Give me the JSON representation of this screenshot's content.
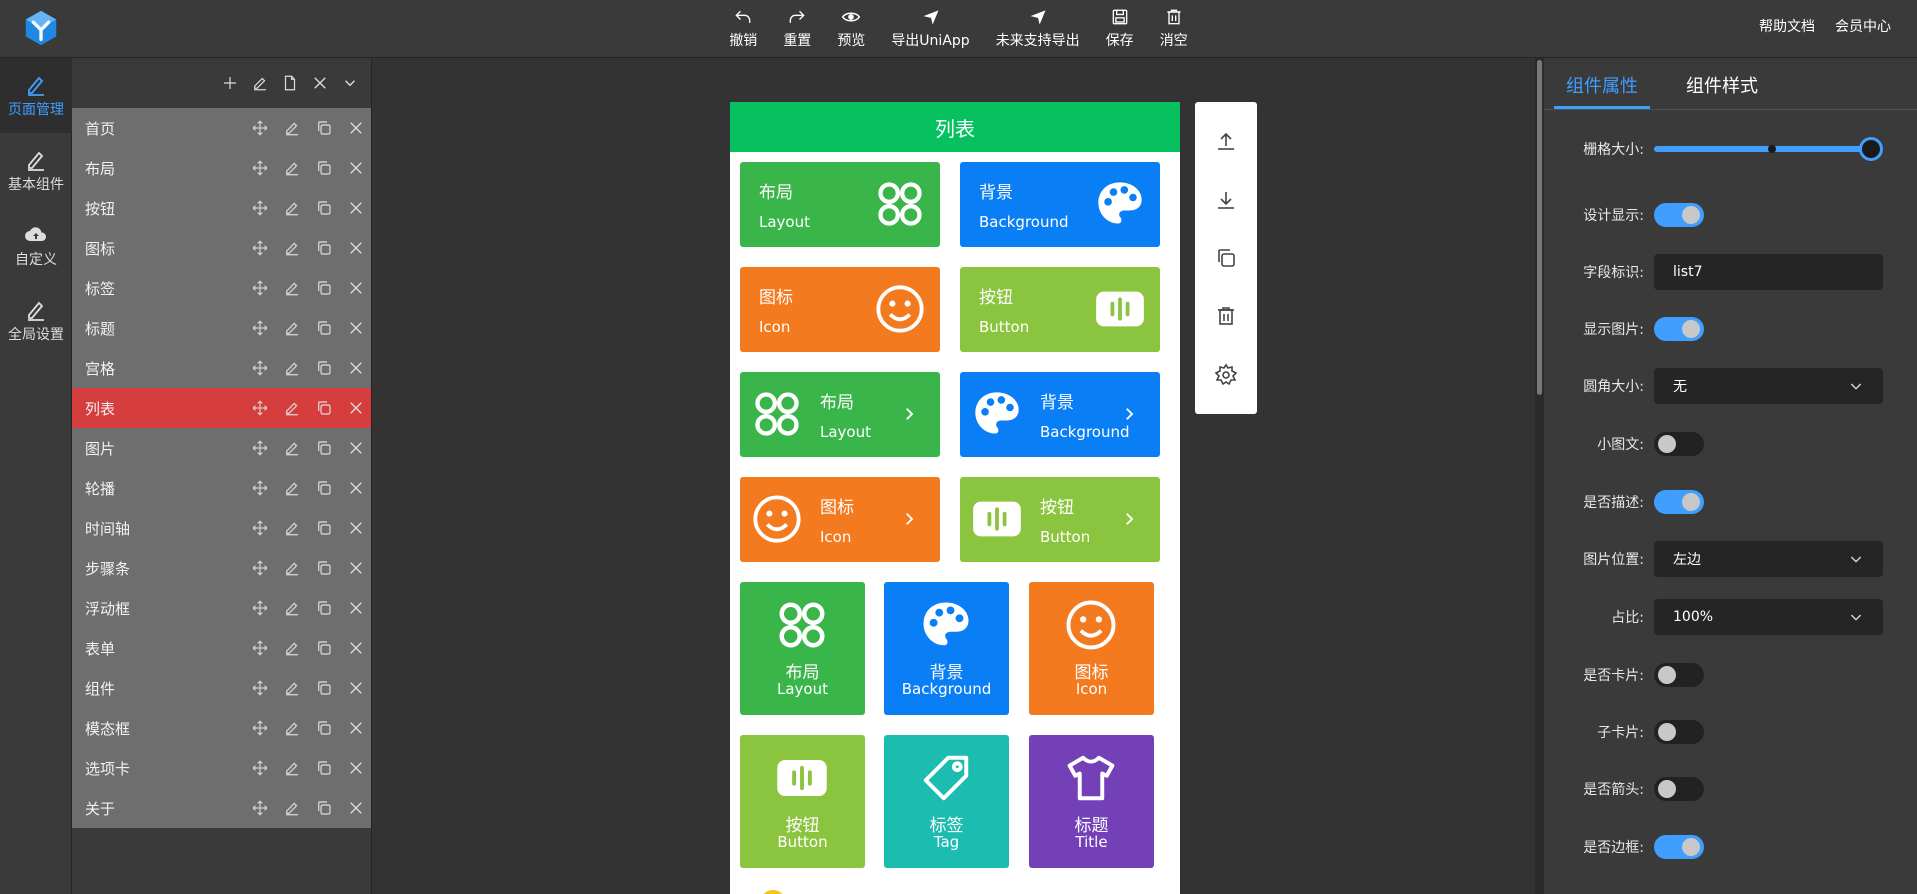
{
  "toolbar": {
    "undo": "撤销",
    "redo": "重置",
    "preview": "预览",
    "export_uniapp": "导出UniApp",
    "future_export": "未来支持导出",
    "save": "保存",
    "clear": "消空"
  },
  "top_links": {
    "help": "帮助文档",
    "member": "会员中心"
  },
  "left_nav": [
    {
      "label": "页面管理",
      "icon": "pencil-icon",
      "active": true
    },
    {
      "label": "基本组件",
      "icon": "pencil-icon",
      "active": false
    },
    {
      "label": "自定义",
      "icon": "cloud-upload-icon",
      "active": false
    },
    {
      "label": "全局设置",
      "icon": "pencil-icon",
      "active": false
    }
  ],
  "pages": [
    {
      "name": "首页"
    },
    {
      "name": "布局"
    },
    {
      "name": "按钮"
    },
    {
      "name": "图标"
    },
    {
      "name": "标签"
    },
    {
      "name": "标题"
    },
    {
      "name": "宫格"
    },
    {
      "name": "列表",
      "active": true
    },
    {
      "name": "图片"
    },
    {
      "name": "轮播"
    },
    {
      "name": "时间轴"
    },
    {
      "name": "步骤条"
    },
    {
      "name": "浮动框"
    },
    {
      "name": "表单"
    },
    {
      "name": "组件"
    },
    {
      "name": "模态框"
    },
    {
      "name": "选项卡"
    },
    {
      "name": "关于"
    }
  ],
  "phone": {
    "title": "列表",
    "cards": [
      {
        "title": "布局",
        "subtitle": "Layout",
        "icon": "layout-icon",
        "color": "#3ab54a"
      },
      {
        "title": "背景",
        "subtitle": "Background",
        "icon": "palette-icon",
        "color": "#0a7ff5"
      },
      {
        "title": "图标",
        "subtitle": "Icon",
        "icon": "smile-icon",
        "color": "#f47a1f"
      },
      {
        "title": "按钮",
        "subtitle": "Button",
        "icon": "button-icon",
        "color": "#8bc53f"
      },
      {
        "title": "布局",
        "subtitle": "Layout",
        "icon": "layout-icon",
        "color": "#3ab54a"
      },
      {
        "title": "背景",
        "subtitle": "Background",
        "icon": "palette-icon",
        "color": "#0a7ff5"
      },
      {
        "title": "图标",
        "subtitle": "Icon",
        "icon": "smile-icon",
        "color": "#f47a1f"
      },
      {
        "title": "按钮",
        "subtitle": "Button",
        "icon": "button-icon",
        "color": "#8bc53f"
      },
      {
        "title": "布局",
        "subtitle": "Layout",
        "icon": "layout-icon",
        "color": "#3ab54a"
      },
      {
        "title": "背景",
        "subtitle": "Background",
        "icon": "palette-icon",
        "color": "#0a7ff5"
      },
      {
        "title": "图标",
        "subtitle": "Icon",
        "icon": "smile-icon",
        "color": "#f47a1f"
      },
      {
        "title": "按钮",
        "subtitle": "Button",
        "icon": "button-icon",
        "color": "#8bc53f"
      },
      {
        "title": "标签",
        "subtitle": "Tag",
        "icon": "tag-icon",
        "color": "#1dbcb0"
      },
      {
        "title": "标题",
        "subtitle": "Title",
        "icon": "shirt-icon",
        "color": "#7340b8"
      }
    ]
  },
  "float_tools": [
    "move-up-icon",
    "move-down-icon",
    "copy-icon",
    "trash-icon",
    "settings-icon"
  ],
  "right_panel": {
    "tabs": [
      {
        "label": "组件属性",
        "active": true
      },
      {
        "label": "组件样式",
        "active": false
      }
    ],
    "grid_size_label": "栅格大小:",
    "grid_size_level": 1.0,
    "design_show_label": "设计显示:",
    "design_show": true,
    "field_id_label": "字段标识:",
    "field_id_value": "list7",
    "show_image_label": "显示图片:",
    "show_image": true,
    "radius_label": "圆角大小:",
    "radius_value": "无",
    "small_text_label": "小图文:",
    "small_text": false,
    "describe_label": "是否描述:",
    "describe": true,
    "image_pos_label": "图片位置:",
    "image_pos_value": "左边",
    "ratio_label": "占比:",
    "ratio_value": "100%",
    "is_card_label": "是否卡片:",
    "is_card": false,
    "sub_card_label": "子卡片:",
    "sub_card": false,
    "arrow_label": "是否箭头:",
    "arrow": false,
    "border_label": "是否边框:",
    "border": true
  },
  "colors": {
    "accent": "#409eff",
    "active_page": "#d63d3d",
    "header_green": "#07c160"
  }
}
